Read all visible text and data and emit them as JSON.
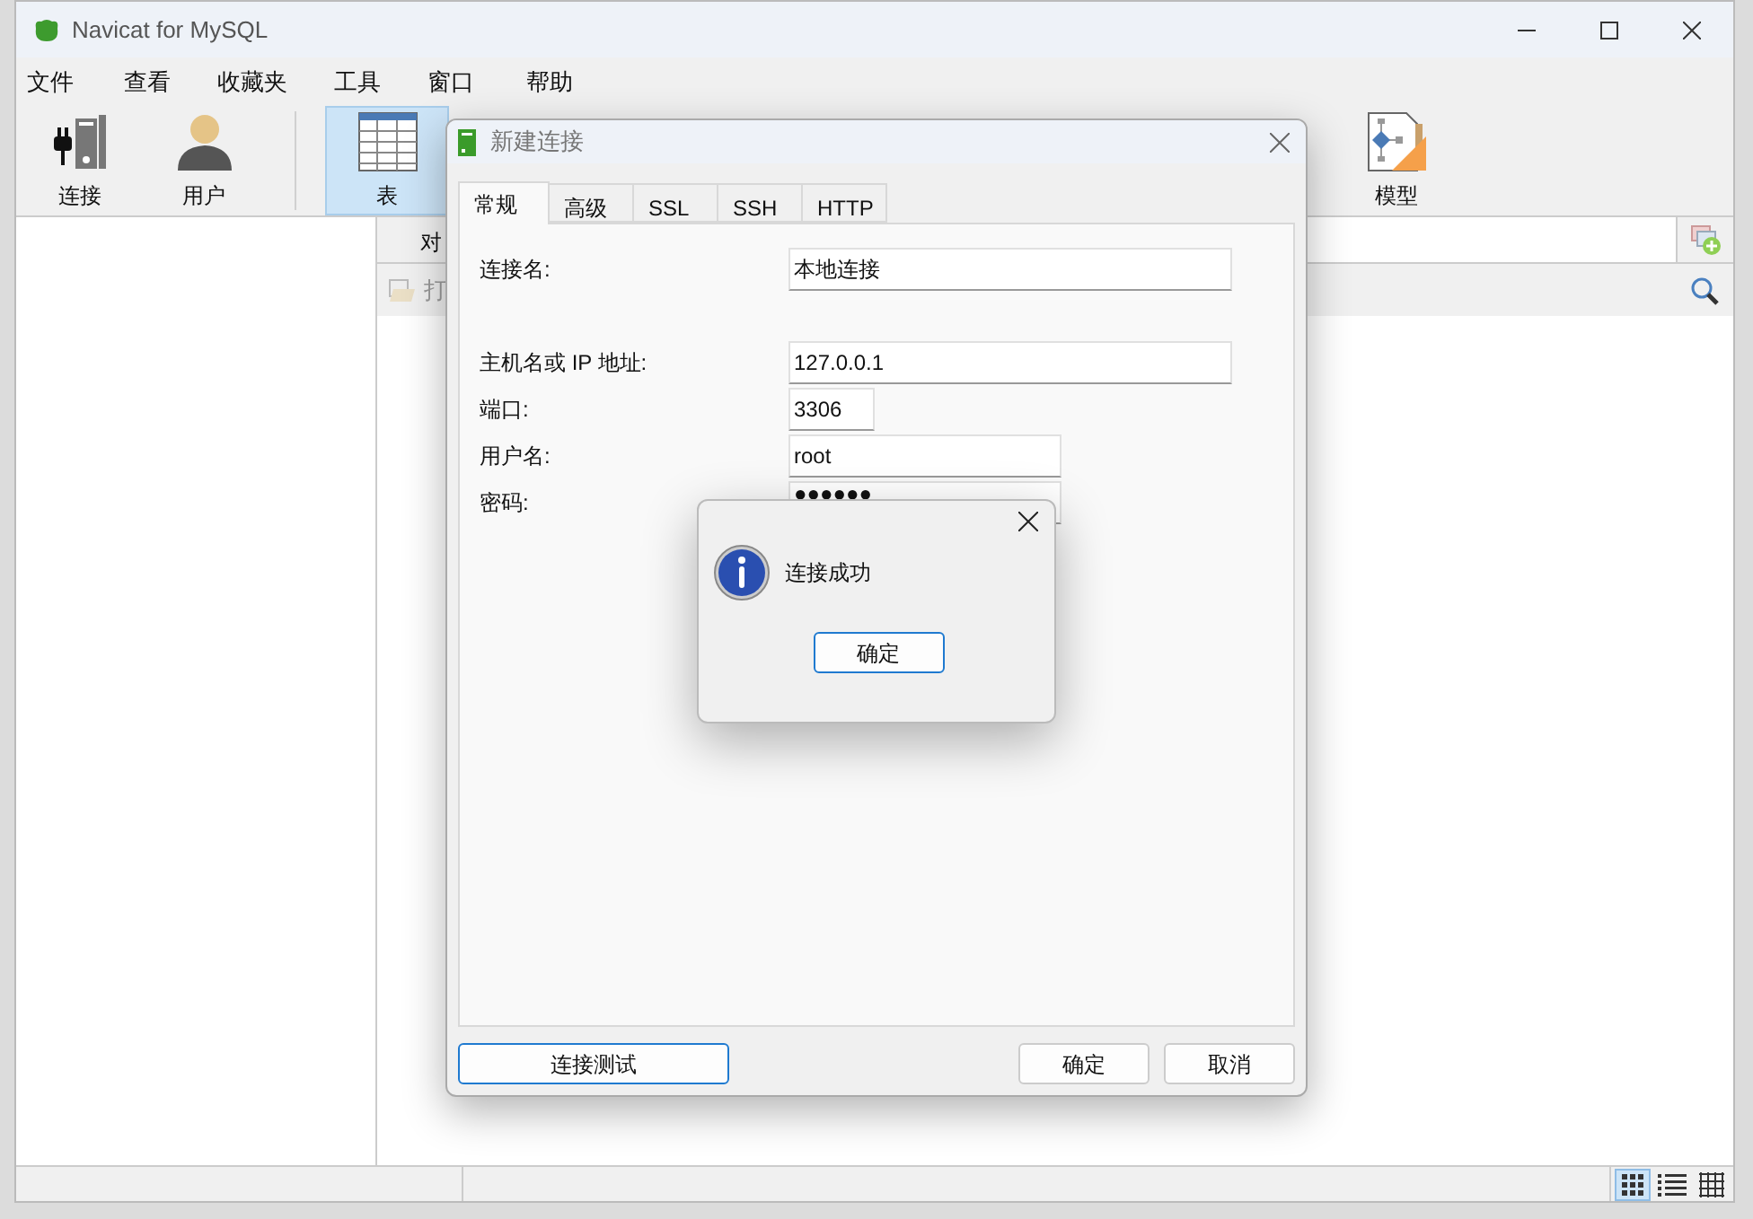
{
  "window": {
    "title": "Navicat for MySQL"
  },
  "menu": [
    "文件",
    "查看",
    "收藏夹",
    "工具",
    "窗口",
    "帮助"
  ],
  "toolbar": [
    {
      "label": "连接",
      "kind": "connection",
      "selected": false
    },
    {
      "label": "用户",
      "kind": "user",
      "selected": false
    },
    {
      "label": "表",
      "kind": "table",
      "selected": true
    },
    {
      "label": "模型",
      "kind": "model",
      "selected": false
    }
  ],
  "object_tab": {
    "label": "对"
  },
  "object_toolbar": {
    "open_button": "打"
  },
  "dialog": {
    "title": "新建连接",
    "tabs": [
      {
        "label": "常规",
        "selected": true
      },
      {
        "label": "高级",
        "selected": false
      },
      {
        "label": "SSL",
        "selected": false
      },
      {
        "label": "SSH",
        "selected": false
      },
      {
        "label": "HTTP",
        "selected": false
      }
    ],
    "fields": [
      {
        "label": "连接名:",
        "value": "本地连接",
        "kind": "wide"
      },
      {
        "label": "主机名或 IP 地址:",
        "value": "127.0.0.1",
        "kind": "wide"
      },
      {
        "label": "端口:",
        "value": "3306",
        "kind": "short"
      },
      {
        "label": "用户名:",
        "value": "root",
        "kind": "medium"
      },
      {
        "label": "密码:",
        "value": "●●●●●●",
        "kind": "medium"
      }
    ],
    "test_button": "连接测试",
    "ok_button": "确定",
    "cancel_button": "取消"
  },
  "message_box": {
    "text": "连接成功",
    "button": "确定"
  },
  "status_bar": {
    "views": [
      {
        "kind": "icons",
        "selected": true
      },
      {
        "kind": "list",
        "selected": false
      },
      {
        "kind": "grid",
        "selected": false
      }
    ]
  }
}
